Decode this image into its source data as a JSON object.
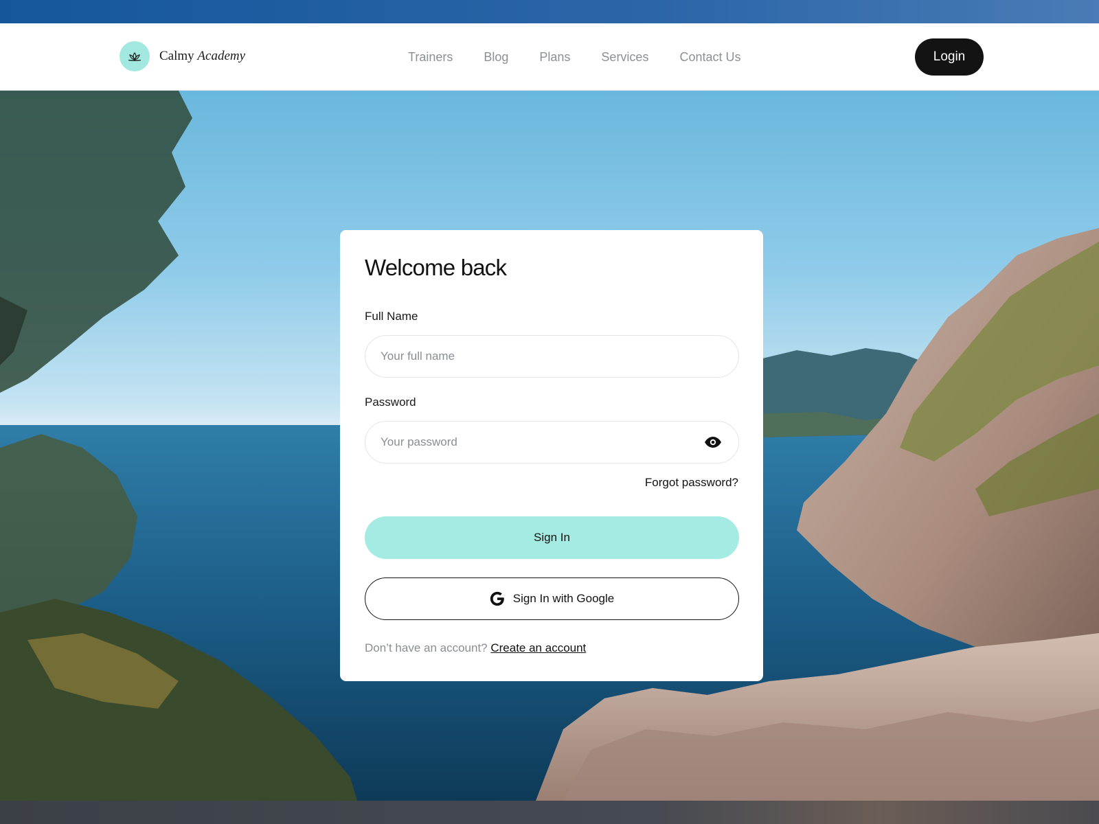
{
  "brand": {
    "name": "Calmy",
    "name_italic": "Academy",
    "logo_icon": "lotus-icon",
    "accent_color": "#a3e8e0"
  },
  "nav": {
    "links": [
      "Trainers",
      "Blog",
      "Plans",
      "Services",
      "Contact Us"
    ],
    "login_label": "Login"
  },
  "form": {
    "title": "Welcome back",
    "name_label": "Full Name",
    "name_placeholder": "Your full name",
    "password_label": "Password",
    "password_placeholder": "Your password",
    "password_toggle_icon": "eye-icon",
    "forgot_label": "Forgot password?",
    "signin_label": "Sign In",
    "google_label": "Sign In with Google",
    "google_icon": "google-g-icon",
    "no_account_text": "Don’t have an account?",
    "create_account_label": "Create an account"
  },
  "colors": {
    "primary_button": "#a3ebe3",
    "dark_button": "#131313",
    "header_strip": "#15569b"
  }
}
